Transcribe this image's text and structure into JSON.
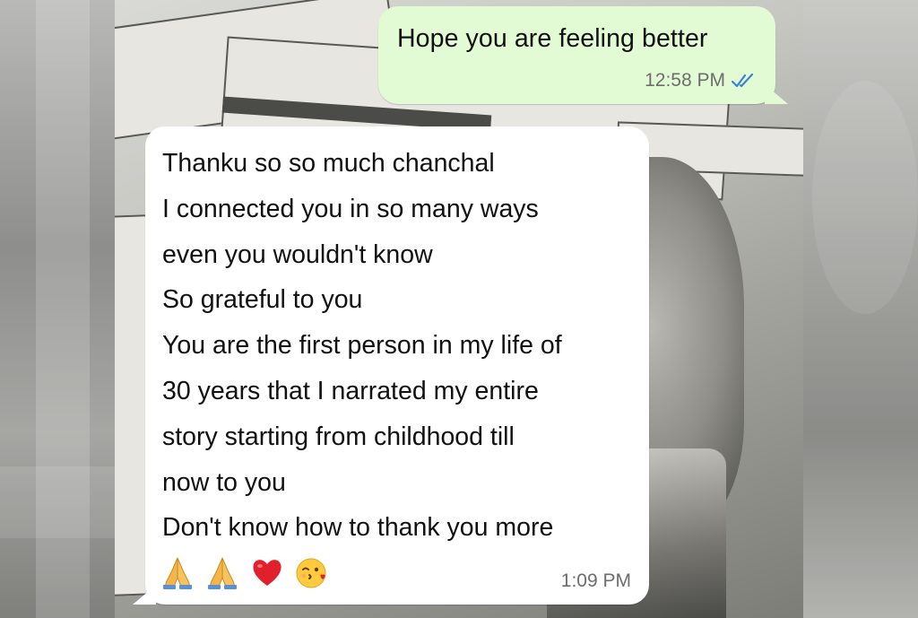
{
  "chat": {
    "outgoing": {
      "text": "Hope you are feeling better",
      "time": "12:58 PM",
      "status_icon": "double-check-read-icon",
      "bubble_color": "#e3fbd5",
      "tick_color": "#3b82d6"
    },
    "incoming": {
      "lines": [
        "Thanku so so much chanchal",
        "I connected you in so many ways",
        "even you wouldn't know",
        "So grateful to you",
        "You are the first person in my life of",
        "30 years that I narrated my entire",
        "story starting from childhood till",
        "now to you",
        "Don't know how to thank you more"
      ],
      "emojis": [
        "folded-hands-icon",
        "folded-hands-icon",
        "red-heart-icon",
        "face-blowing-kiss-icon"
      ],
      "time": "1:09 PM",
      "bubble_color": "#ffffff"
    }
  }
}
